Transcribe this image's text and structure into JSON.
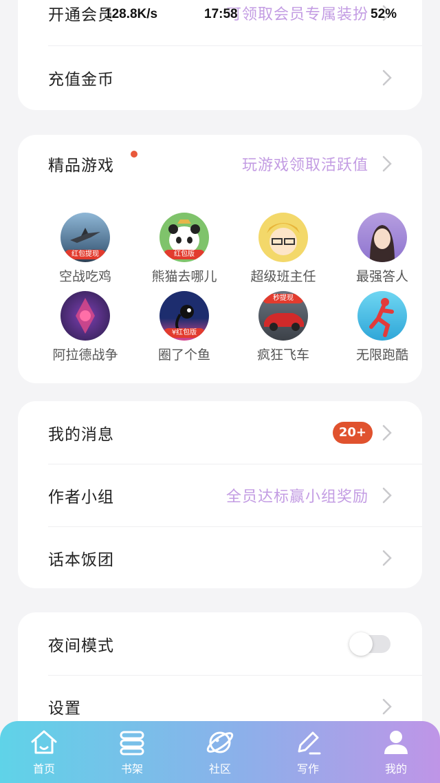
{
  "status_bar": {
    "net_speed": "128.8K/s",
    "time": "17:58",
    "battery": "52%"
  },
  "vip": {
    "label": "开通会员",
    "sub": "可领取会员专属装扮"
  },
  "recharge": {
    "label": "充值金币"
  },
  "games": {
    "title": "精品游戏",
    "sub": "玩游戏领取活跃值",
    "items": [
      {
        "name": "空战吃鸡",
        "tag": "红包提现"
      },
      {
        "name": "熊猫去哪儿",
        "tag": "红包版"
      },
      {
        "name": "超级班主任",
        "tag": ""
      },
      {
        "name": "最强答人",
        "tag": ""
      },
      {
        "name": "阿拉德战争",
        "tag": ""
      },
      {
        "name": "圈了个鱼",
        "tag": "¥红包版"
      },
      {
        "name": "疯狂飞车",
        "tag": "秒提现"
      },
      {
        "name": "无限跑酷",
        "tag": ""
      }
    ]
  },
  "messages": {
    "label": "我的消息",
    "badge": "20+"
  },
  "author_group": {
    "label": "作者小组",
    "sub": "全员达标赢小组奖励"
  },
  "fan_group": {
    "label": "话本饭团"
  },
  "night_mode": {
    "label": "夜间模式",
    "on": false
  },
  "settings": {
    "label": "设置"
  },
  "tabbar": {
    "tabs": [
      {
        "label": "首页",
        "icon": "home-icon"
      },
      {
        "label": "书架",
        "icon": "bookshelf-icon"
      },
      {
        "label": "社区",
        "icon": "planet-icon"
      },
      {
        "label": "写作",
        "icon": "pen-icon"
      },
      {
        "label": "我的",
        "icon": "profile-icon"
      }
    ]
  },
  "colors": {
    "accent_text": "#c39ce3",
    "badge": "#e0522e",
    "dot": "#e9593b"
  }
}
